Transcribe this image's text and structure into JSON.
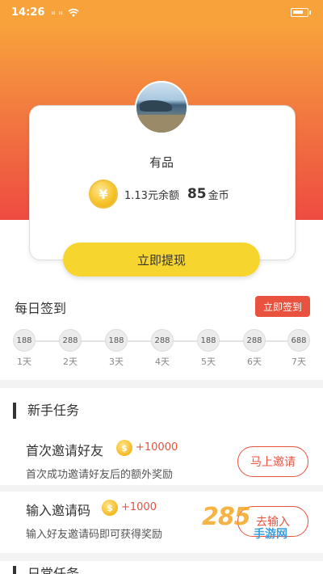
{
  "status_bar": {
    "time": "14:26",
    "signal_1": "ᵢₗₗ",
    "signal_2": "ᵢₗₗ"
  },
  "profile": {
    "username": "有品",
    "coin_symbol": "¥",
    "balance": "1.13元余额",
    "gold_amount": "85",
    "gold_unit": "金币"
  },
  "withdraw_button": "立即提现",
  "daily_signin": {
    "title": "每日签到",
    "button": "立即签到",
    "days": [
      {
        "points": "188",
        "label": "1天"
      },
      {
        "points": "288",
        "label": "2天"
      },
      {
        "points": "188",
        "label": "3天"
      },
      {
        "points": "288",
        "label": "4天"
      },
      {
        "points": "188",
        "label": "5天"
      },
      {
        "points": "288",
        "label": "6天"
      },
      {
        "points": "688",
        "label": "7天"
      }
    ]
  },
  "newbie_tasks": {
    "title": "新手任务",
    "items": [
      {
        "name": "首次邀请好友",
        "coin_symbol": "$",
        "reward": "+10000",
        "desc": "首次成功邀请好友后的额外奖励",
        "action": "马上邀请"
      },
      {
        "name": "输入邀请码",
        "coin_symbol": "$",
        "reward": "+1000",
        "desc": "输入好友邀请码即可获得奖励",
        "action": "去输入"
      }
    ]
  },
  "daily_tasks": {
    "title": "日常任务"
  },
  "watermark": {
    "number": "285",
    "text": "手游网"
  },
  "colors": {
    "accent_red": "#e8523f",
    "button_yellow": "#f7d52f",
    "gradient_top": "#f8a33c",
    "gradient_bottom": "#ee4b41"
  }
}
